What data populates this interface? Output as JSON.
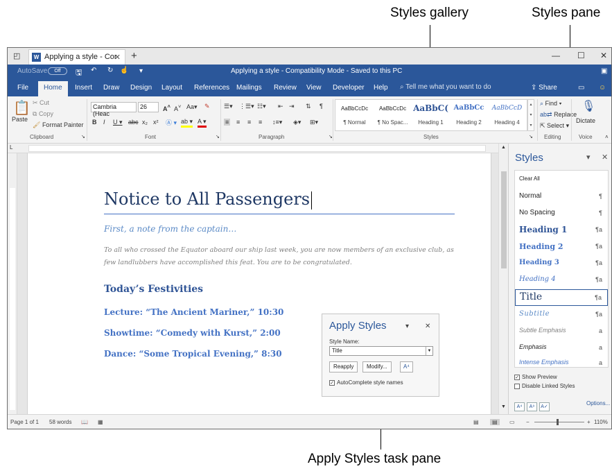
{
  "callouts": {
    "styles_gallery": "Styles gallery",
    "styles_pane": "Styles pane",
    "apply_styles_task_pane": "Apply Styles task pane"
  },
  "tabstrip": {
    "tab_title": "Applying a style - Cor",
    "new_tab": "+",
    "minimize": "—",
    "maximize": "☐",
    "close": "✕"
  },
  "titlebar": {
    "autosave_label": "AutoSave",
    "autosave_state": "Off",
    "document_title": "Applying a style - Compatibility Mode - Saved to this PC"
  },
  "ribbon_tabs": [
    "File",
    "Home",
    "Insert",
    "Draw",
    "Design",
    "Layout",
    "References",
    "Mailings",
    "Review",
    "View",
    "Developer",
    "Help"
  ],
  "tell_me": "Tell me what you want to do",
  "share": "Share",
  "ribbon": {
    "clipboard": {
      "paste": "Paste",
      "cut": "Cut",
      "copy": "Copy",
      "format_painter": "Format Painter",
      "group": "Clipboard"
    },
    "font": {
      "font_name": "Cambria (Heac",
      "font_size": "26",
      "group": "Font"
    },
    "paragraph": {
      "group": "Paragraph"
    },
    "styles_gallery": [
      {
        "preview": "AaBbCcDc",
        "name": "¶ Normal"
      },
      {
        "preview": "AaBbCcDc",
        "name": "¶ No Spac..."
      },
      {
        "preview": "AaBbC(",
        "name": "Heading 1"
      },
      {
        "preview": "AaBbCc",
        "name": "Heading 2"
      },
      {
        "preview": "AaBbCcD",
        "name": "Heading 4"
      }
    ],
    "styles_group": "Styles",
    "editing": {
      "find": "Find",
      "replace": "Replace",
      "select": "Select",
      "group": "Editing"
    },
    "voice": {
      "dictate": "Dictate",
      "group": "Voice"
    }
  },
  "document": {
    "title": "Notice to All Passengers",
    "subtitle": "First, a note from the captain…",
    "body": "To all who crossed the Equator aboard our ship last week, you are now members of an exclusive club, as few landlubbers have accomplished this feat. You are to be congratulated.",
    "heading": "Today’s Festivities",
    "items": [
      "Lecture: “The Ancient Mariner,” 10:30",
      "Showtime: “Comedy with Kurst,” 2:00",
      "Dance: “Some Tropical Evening,” 8:30"
    ]
  },
  "apply_styles": {
    "title": "Apply Styles",
    "style_name_label": "Style Name:",
    "style_name_value": "Title",
    "reapply": "Reapply",
    "modify": "Modify...",
    "autocomplete": "AutoComplete style names",
    "autocomplete_checked": true
  },
  "styles_pane": {
    "title": "Styles",
    "items": [
      {
        "name": "Clear All",
        "mark": ""
      },
      {
        "name": "Normal",
        "mark": "¶"
      },
      {
        "name": "No Spacing",
        "mark": "¶"
      },
      {
        "name": "Heading 1",
        "mark": "¶a"
      },
      {
        "name": "Heading 2",
        "mark": "¶a"
      },
      {
        "name": "Heading 3",
        "mark": "¶a"
      },
      {
        "name": "Heading 4",
        "mark": "¶a"
      },
      {
        "name": "Title",
        "mark": "¶a"
      },
      {
        "name": "Subtitle",
        "mark": "¶a"
      },
      {
        "name": "Subtle Emphasis",
        "mark": "a"
      },
      {
        "name": "Emphasis",
        "mark": "a"
      },
      {
        "name": "Intense Emphasis",
        "mark": "a"
      }
    ],
    "selected": "Title",
    "show_preview": "Show Preview",
    "show_preview_checked": true,
    "disable_linked": "Disable Linked Styles",
    "disable_linked_checked": false,
    "options": "Options..."
  },
  "status": {
    "page": "Page 1 of 1",
    "words": "58 words",
    "zoom": "110%"
  },
  "colors": {
    "accent": "#2b579a",
    "heading": "#2f5496",
    "title": "#1f3864",
    "subtitle": "#5b8ac6"
  }
}
